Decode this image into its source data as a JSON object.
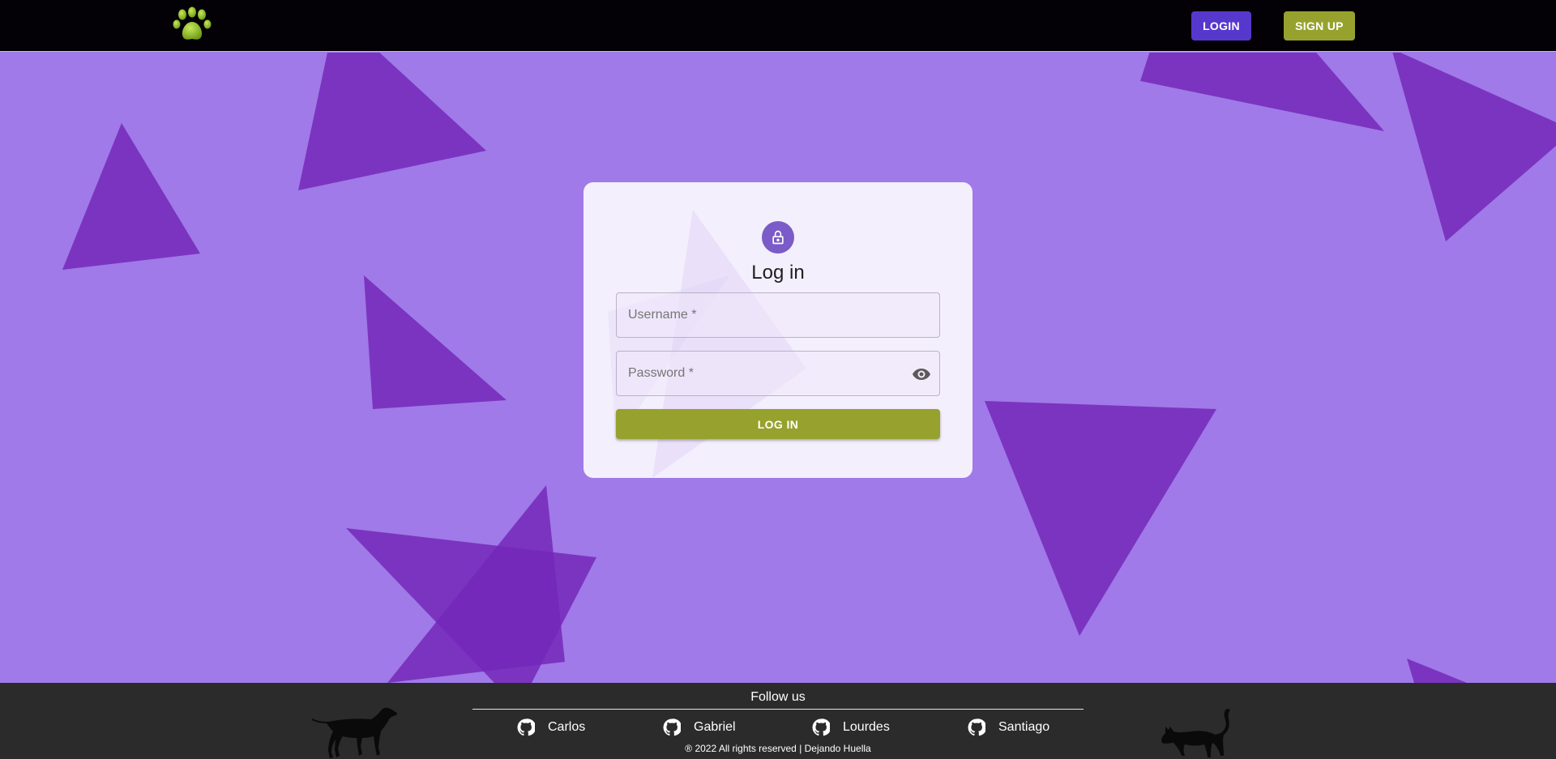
{
  "header": {
    "logo_icon": "paw-icon",
    "login_label": "LOGIN",
    "signup_label": "SIGN UP"
  },
  "login_card": {
    "icon": "lock-icon",
    "title": "Log in",
    "username_placeholder": "Username *",
    "password_placeholder": "Password *",
    "toggle_icon": "eye-icon",
    "submit_label": "LOG IN"
  },
  "footer": {
    "follow_label": "Follow us",
    "links": [
      {
        "label": "Carlos",
        "icon": "github-icon"
      },
      {
        "label": "Gabriel",
        "icon": "github-icon"
      },
      {
        "label": "Lourdes",
        "icon": "github-icon"
      },
      {
        "label": "Santiago",
        "icon": "github-icon"
      }
    ],
    "copyright": "® 2022 All rights reserved | Dejando Huella",
    "left_image": "dog-silhouette",
    "right_image": "cat-silhouette"
  },
  "colors": {
    "background": "#a07ae8",
    "triangle": "#7428b8",
    "header_bg": "#030105",
    "login_button": "#5738cc",
    "accent_green": "#97a22e",
    "footer_bg": "#2b2b2b"
  }
}
